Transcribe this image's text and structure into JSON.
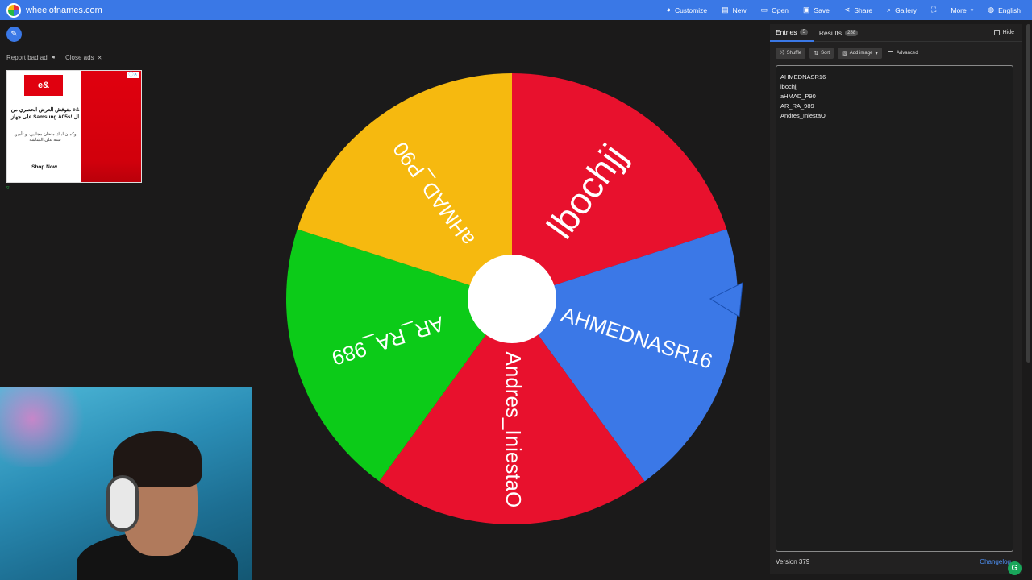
{
  "site": {
    "name": "wheelofnames.com"
  },
  "nav": [
    {
      "label": "Customize",
      "icon": "palette-icon",
      "glyph": "◕"
    },
    {
      "label": "New",
      "icon": "file-icon",
      "glyph": "▤"
    },
    {
      "label": "Open",
      "icon": "folder-icon",
      "glyph": "▭"
    },
    {
      "label": "Save",
      "icon": "save-icon",
      "glyph": "▣"
    },
    {
      "label": "Share",
      "icon": "share-icon",
      "glyph": "⋖"
    },
    {
      "label": "Gallery",
      "icon": "search-icon",
      "glyph": "⌕"
    },
    {
      "label": "",
      "icon": "fullscreen-icon",
      "glyph": "⛶"
    },
    {
      "label": "More",
      "icon": "",
      "glyph": ""
    },
    {
      "label": "English",
      "icon": "globe-icon",
      "glyph": "◍"
    }
  ],
  "ad": {
    "report_label": "Report bad ad",
    "close_label": "Close ads",
    "logo": "e&",
    "headline": "متوفش العرض الحصري من e& على جهاز Samsung A05s! ال",
    "sub": "وكمان لباك منحان مجانين، و تأمين سنة على الشاشة",
    "cta": "Shop Now"
  },
  "wheel": {
    "segments": [
      {
        "label": "lbochjj",
        "color": "#e8112d"
      },
      {
        "label": "AHMEDNASR16",
        "color": "#3b78e7"
      },
      {
        "label": "Andres_IniestaO",
        "color": "#e8112d"
      },
      {
        "label": "AR_RA_989",
        "color": "#0ccb18"
      },
      {
        "label": "aHMAD_P90",
        "color": "#f6b90f"
      }
    ],
    "hub_color": "#ffffff",
    "pointer_color": "#3b78e7"
  },
  "panel": {
    "tab_entries": "Entries",
    "entries_count": "5",
    "tab_results": "Results",
    "results_count": "288",
    "hide_label": "Hide",
    "shuffle_label": "Shuffle",
    "sort_label": "Sort",
    "add_image_label": "Add image",
    "advanced_label": "Advanced",
    "entries": [
      "AHMEDNASR16",
      "lbochjj",
      "aHMAD_P90",
      "AR_RA_989",
      "Andres_IniestaO"
    ],
    "version": "Version 379",
    "changelog": "Changelog"
  }
}
